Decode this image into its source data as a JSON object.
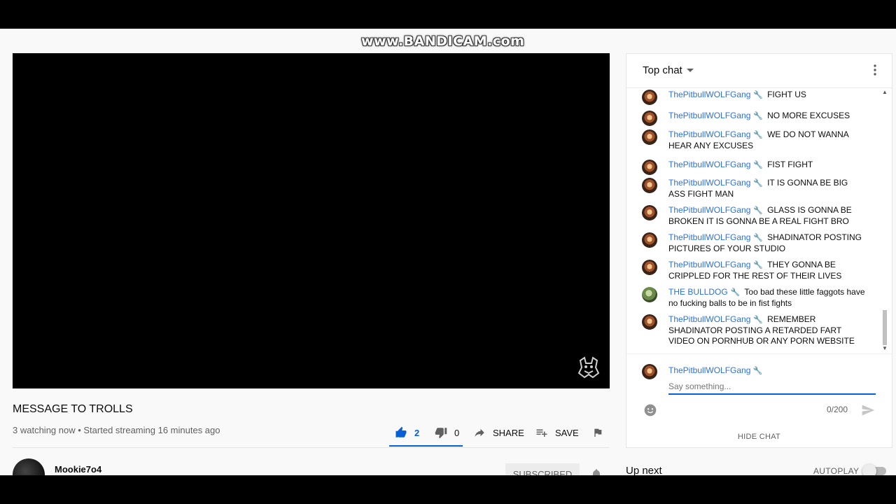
{
  "watermark": "www.BANDICAM.com",
  "video": {
    "title": "MESSAGE TO TROLLS",
    "meta": "3 watching now • Started streaming 16 minutes ago",
    "likes": "2",
    "dislikes": "0",
    "share_label": "SHARE",
    "save_label": "SAVE"
  },
  "owner": {
    "name": "Mookie7o4",
    "subscribe_label": "SUBSCRIBED"
  },
  "chat": {
    "mode_label": "Top chat",
    "messages": [
      {
        "author": "ThePitbullWOLFGang",
        "text": "FIGHT US"
      },
      {
        "author": "ThePitbullWOLFGang",
        "text": "NO MORE EXCUSES"
      },
      {
        "author": "ThePitbullWOLFGang",
        "text": "WE DO NOT WANNA HEAR ANY EXCUSES"
      },
      {
        "author": "ThePitbullWOLFGang",
        "text": "FIST FIGHT"
      },
      {
        "author": "ThePitbullWOLFGang",
        "text": "IT IS GONNA BE BIG ASS FIGHT MAN"
      },
      {
        "author": "ThePitbullWOLFGang",
        "text": "GLASS IS GONNA BE BROKEN IT IS GONNA BE A REAL FIGHT BRO"
      },
      {
        "author": "ThePitbullWOLFGang",
        "text": "SHADINATOR POSTING PICTURES OF YOUR STUDIO"
      },
      {
        "author": "ThePitbullWOLFGang",
        "text": "THEY GONNA BE CRIPPLED FOR THE REST OF THEIR LIVES"
      },
      {
        "author": "THE BULLDOG",
        "text": "Too bad these little faggots have no fucking balls to be in fist fights"
      },
      {
        "author": "ThePitbullWOLFGang",
        "text": "REMEMBER SHADINATOR POSTING A RETARDED FART VIDEO ON PORNHUB OR ANY PORN WEBSITE"
      }
    ],
    "input_author": "ThePitbullWOLFGang",
    "input_placeholder": "Say something...",
    "char_count": "0/200",
    "hide_label": "HIDE CHAT"
  },
  "sidebar": {
    "up_next_label": "Up next",
    "autoplay_label": "AUTOPLAY"
  },
  "colors": {
    "accent": "#065fd4",
    "author": "#2c71d8"
  }
}
